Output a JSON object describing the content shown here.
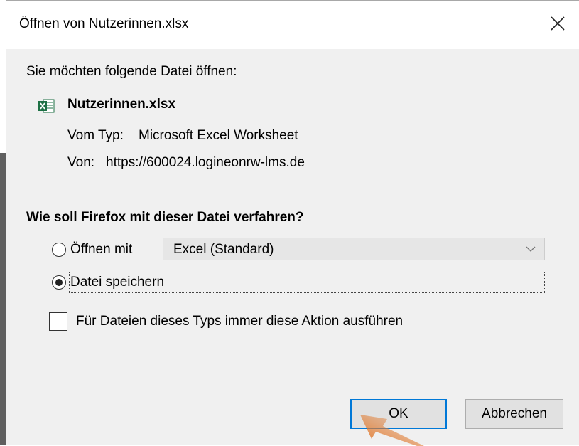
{
  "dialog": {
    "title": "Öffnen von Nutzerinnen.xlsx",
    "intro": "Sie möchten folgende Datei öffnen:",
    "file": {
      "name": "Nutzerinnen.xlsx",
      "type_label": "Vom Typ:",
      "type_value": "Microsoft Excel Worksheet",
      "from_label": "Von:",
      "from_value": "https://600024.logineonrw-lms.de"
    },
    "question": "Wie soll Firefox mit dieser Datei verfahren?",
    "options": {
      "open_with_label": "Öffnen mit",
      "open_with_app": "Excel (Standard)",
      "save_label": "Datei speichern",
      "selected": "save"
    },
    "remember_label": "Für Dateien dieses Typs immer diese Aktion ausführen",
    "remember_checked": false,
    "buttons": {
      "ok": "OK",
      "cancel": "Abbrechen"
    }
  },
  "colors": {
    "focus_blue": "#0078d7",
    "excel_green": "#1e7145",
    "annotation_arrow": "#e07a2f"
  }
}
